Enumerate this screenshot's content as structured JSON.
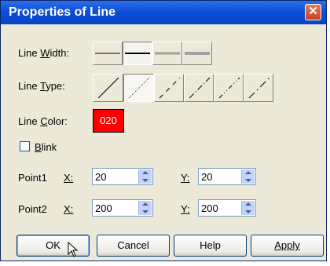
{
  "dialog": {
    "title": "Properties of Line",
    "close": "✕"
  },
  "line_width": {
    "label_pre": "Line ",
    "label_u": "W",
    "label_post": "idth:"
  },
  "line_type": {
    "label_pre": "Line ",
    "label_u": "T",
    "label_post": "ype:"
  },
  "line_color": {
    "label_pre": "Line ",
    "label_u": "C",
    "label_post": "olor:",
    "value": "020",
    "color": "#ff0000"
  },
  "blink": {
    "label_u": "B",
    "label_post": "link",
    "checked": false
  },
  "point1": {
    "label": "Point1",
    "x_label": "X:",
    "x_value": "20",
    "y_label": "Y:",
    "y_value": "20"
  },
  "point2": {
    "label": "Point2",
    "x_label": "X:",
    "x_value": "200",
    "y_label": "Y:",
    "y_value": "200"
  },
  "buttons": {
    "ok": "OK",
    "cancel": "Cancel",
    "help": "Help",
    "apply": "Apply"
  }
}
